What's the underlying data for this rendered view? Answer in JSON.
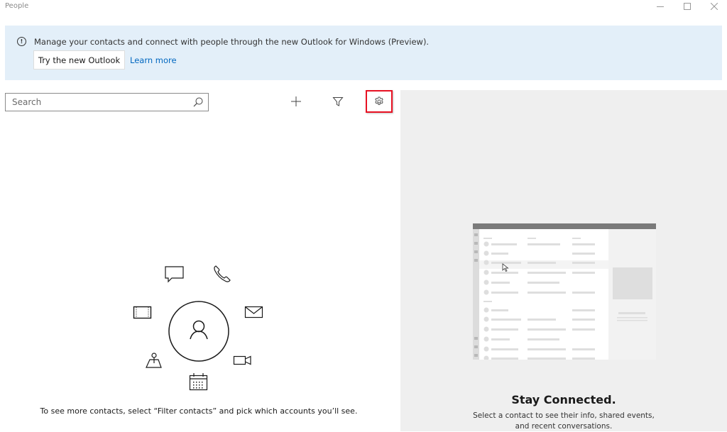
{
  "window": {
    "title": "People",
    "controls": {
      "minimize": "minimize-icon",
      "maximize": "maximize-icon",
      "close": "close-icon"
    }
  },
  "banner": {
    "icon": "info-icon",
    "message": "Manage your contacts and connect with people through the new Outlook for Windows (Preview).",
    "try_button": "Try the new Outlook",
    "learn_more": "Learn more"
  },
  "toolbar": {
    "search_placeholder": "Search",
    "search_value": "",
    "search_icon": "search-icon",
    "add_icon": "plus-icon",
    "filter_icon": "filter-icon",
    "settings_icon": "gear-icon",
    "highlight_color": "#e81123"
  },
  "empty_state": {
    "icons": [
      "chat-icon",
      "phone-icon",
      "film-icon",
      "mail-icon",
      "person-icon",
      "map-pin-icon",
      "video-icon",
      "calendar-icon"
    ],
    "hint": "To see more contacts, select “Filter contacts” and pick which accounts you’ll see."
  },
  "detail_pane": {
    "title": "Stay Connected.",
    "subtitle_line1": "Select a contact to see their info, shared events,",
    "subtitle_line2": "and recent conversations."
  },
  "colors": {
    "banner_bg": "#e3eff9",
    "link": "#0067c0",
    "pane_bg": "#efefef"
  }
}
